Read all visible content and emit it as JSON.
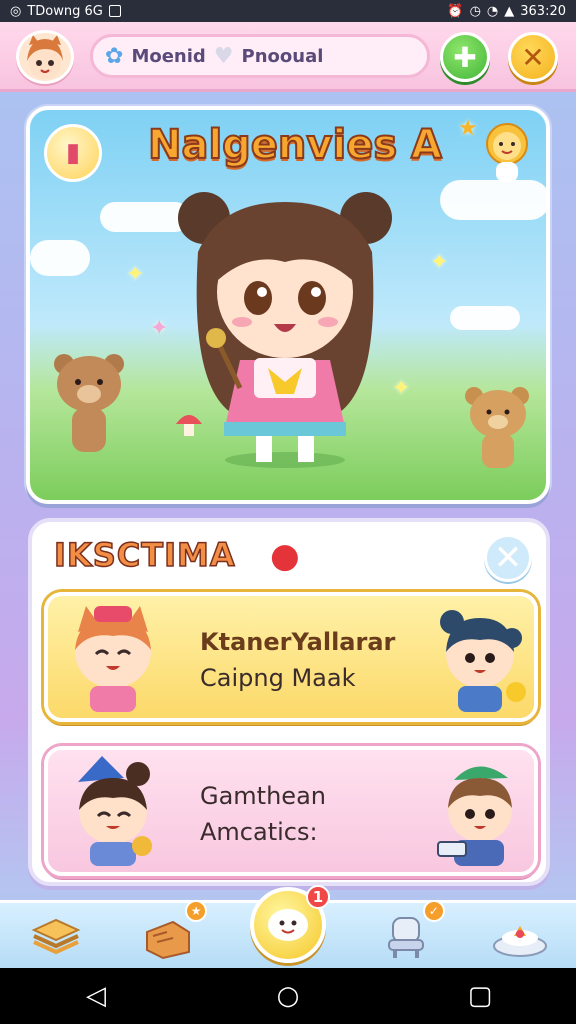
{
  "status_bar": {
    "left_text": "TDowng 6G",
    "time": "363:20"
  },
  "app_bar": {
    "search_pill": {
      "item1": "Moenid",
      "item2": "Pnooual"
    },
    "add_icon": "plus-icon",
    "close_icon": "close-icon"
  },
  "hero": {
    "title": "Nalgenvies A"
  },
  "panel": {
    "title": "IKSCTIMA",
    "cards": [
      {
        "line1": "KtanerYallarar",
        "line2": "Caipng Maak"
      },
      {
        "line1": "Gamthean",
        "line2": "Amcatics:"
      }
    ]
  },
  "bottom_nav": {
    "items": [
      {
        "icon": "sandwich-icon"
      },
      {
        "icon": "toast-icon"
      },
      {
        "icon": "smiley-center-icon",
        "badge": "1"
      },
      {
        "icon": "chair-icon"
      },
      {
        "icon": "cake-icon"
      }
    ]
  },
  "colors": {
    "accent_pink": "#f8c3df",
    "accent_yellow": "#fcd96a",
    "accent_green": "#43b63a"
  }
}
